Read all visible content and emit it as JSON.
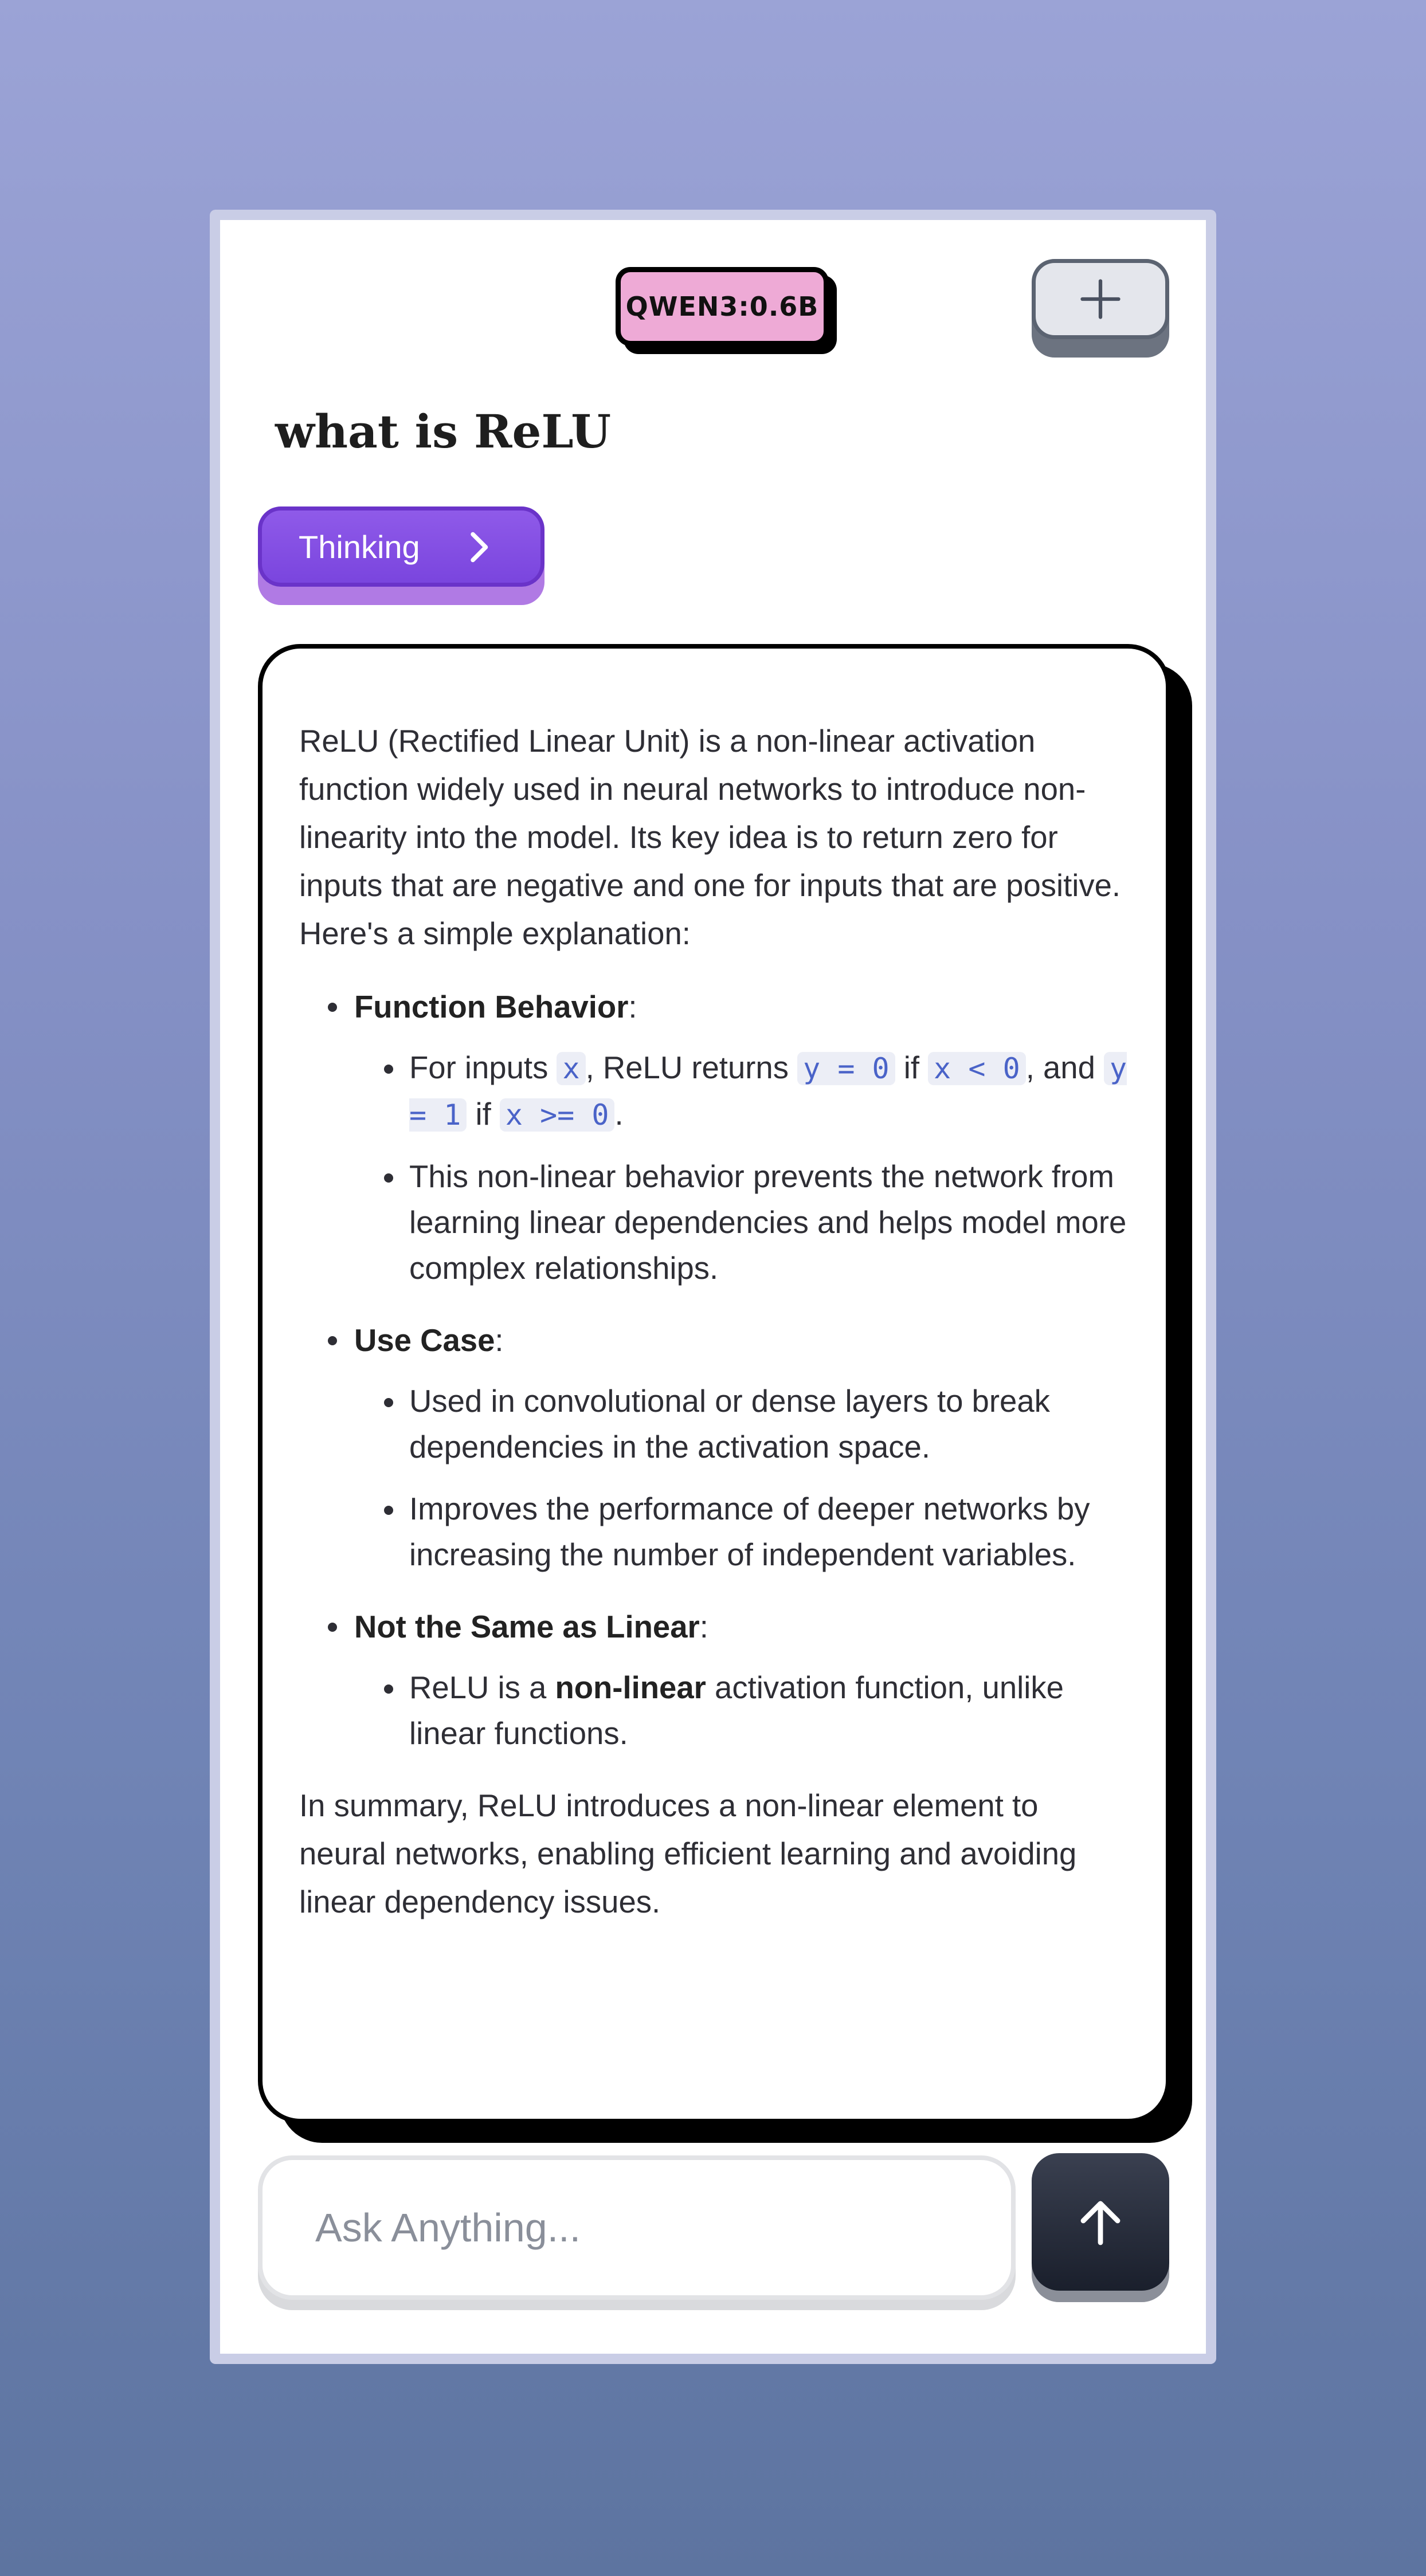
{
  "header": {
    "model_label": "QWEN3:0.6B",
    "new_chat_icon": "plus-icon"
  },
  "conversation": {
    "question": "what is ReLU",
    "thinking_label": "Thinking",
    "thinking_icon": "chevron-right-icon"
  },
  "answer": {
    "intro": "ReLU (Rectified Linear Unit) is a non-linear activation function widely used in neural networks to introduce non-linearity into the model. Its key idea is to return zero for inputs that are negative and one for inputs that are positive. Here's a simple explanation:",
    "sections": [
      {
        "heading": "Function Behavior",
        "colon": ":",
        "item1": {
          "t1": "For inputs ",
          "c1": "x",
          "t2": ", ReLU returns ",
          "c2": "y = 0",
          "t3": " if ",
          "c3": "x < 0",
          "t4": ", and ",
          "c4": "y = 1",
          "t5": " if ",
          "c5": "x >= 0",
          "t6": "."
        },
        "item2": "This non-linear behavior prevents the network from learning linear dependencies and helps model more complex relationships."
      },
      {
        "heading": "Use Case",
        "colon": ":",
        "item1": "Used in convolutional or dense layers to break dependencies in the activation space.",
        "item2": "Improves the performance of deeper networks by increasing the number of independent variables."
      },
      {
        "heading": "Not the Same as Linear",
        "colon": ":",
        "item1": {
          "t1": "ReLU is a ",
          "b1": "non-linear",
          "t2": " activation function, unlike linear functions."
        }
      }
    ],
    "summary": "In summary, ReLU introduces a non-linear element to neural networks, enabling efficient learning and avoiding linear dependency issues."
  },
  "composer": {
    "placeholder": "Ask Anything...",
    "send_icon": "arrow-up-icon"
  },
  "colors": {
    "badge": "#eeaad6",
    "thinking": "#7a45de",
    "send": "#1a1f2c",
    "code": "#4a63c8"
  }
}
